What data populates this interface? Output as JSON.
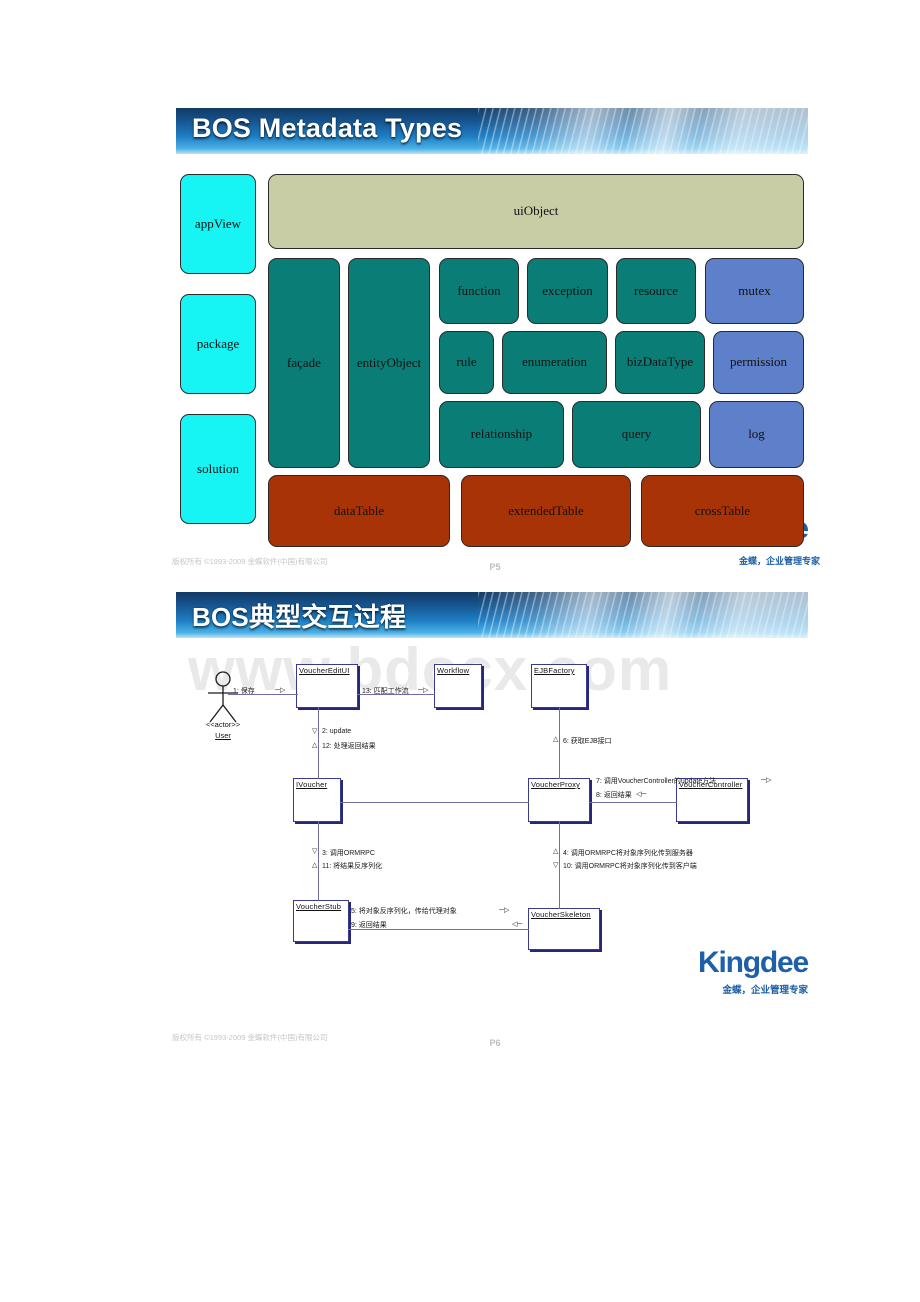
{
  "slide1": {
    "title": "BOS Metadata Types",
    "groups": {
      "left_column": [
        "appView",
        "package",
        "solution"
      ],
      "ui_layer": [
        "uiObject"
      ],
      "tall": [
        "façade",
        "entityObject"
      ],
      "row1": [
        "function",
        "exception",
        "resource",
        "mutex"
      ],
      "row2": [
        "rule",
        "enumeration",
        "bizDataType",
        "permission"
      ],
      "row3": [
        "relationship",
        "query",
        "log"
      ],
      "table_row": [
        "dataTable",
        "extendedTable",
        "crossTable"
      ]
    },
    "blocks": [
      {
        "label": "appView",
        "color": "cyan"
      },
      {
        "label": "package",
        "color": "cyan"
      },
      {
        "label": "solution",
        "color": "cyan"
      },
      {
        "label": "uiObject",
        "color": "sage"
      },
      {
        "label": "façade",
        "color": "teal"
      },
      {
        "label": "entityObject",
        "color": "teal"
      },
      {
        "label": "function",
        "color": "teal"
      },
      {
        "label": "exception",
        "color": "teal"
      },
      {
        "label": "resource",
        "color": "teal"
      },
      {
        "label": "mutex",
        "color": "blue"
      },
      {
        "label": "rule",
        "color": "teal"
      },
      {
        "label": "enumeration",
        "color": "teal"
      },
      {
        "label": "bizDataType",
        "color": "teal"
      },
      {
        "label": "permission",
        "color": "blue"
      },
      {
        "label": "relationship",
        "color": "teal"
      },
      {
        "label": "query",
        "color": "teal"
      },
      {
        "label": "log",
        "color": "blue"
      },
      {
        "label": "dataTable",
        "color": "brick"
      },
      {
        "label": "extendedTable",
        "color": "brick"
      },
      {
        "label": "crossTable",
        "color": "brick"
      }
    ],
    "logo_ghost": "e",
    "footer": {
      "copyright": "版权所有 ©1993-2009 金蝶软件(中国)有限公司",
      "page": "P5",
      "tagline": "金蝶，企业管理专家"
    }
  },
  "slide2": {
    "title": "BOS典型交互过程",
    "watermark": "www.bdocx.com",
    "actor": {
      "stereotype": "<<actor>>",
      "name": "User"
    },
    "nodes": [
      {
        "name": "VoucherEditUI"
      },
      {
        "name": "Workflow"
      },
      {
        "name": "EJBFactory"
      },
      {
        "name": "IVoucher"
      },
      {
        "name": "VoucherProxy"
      },
      {
        "name": "VoucherController"
      },
      {
        "name": "VoucherStub"
      },
      {
        "name": "VoucherSkeleton"
      }
    ],
    "messages": [
      {
        "n": "1",
        "text": "1: 保存"
      },
      {
        "n": "13",
        "text": "13: 匹配工作流"
      },
      {
        "n": "2",
        "text": "2: update"
      },
      {
        "n": "12",
        "text": "12: 处理返回结果"
      },
      {
        "n": "6",
        "text": "6: 获取EJB接口"
      },
      {
        "n": "7",
        "text": "7: 调用VoucherController的update方法"
      },
      {
        "n": "8",
        "text": "8: 返回结果"
      },
      {
        "n": "3",
        "text": "3: 调用ORMRPC"
      },
      {
        "n": "11",
        "text": "11: 将结果反序列化"
      },
      {
        "n": "4",
        "text": "4: 调用ORMRPC将对象序列化传到服务器"
      },
      {
        "n": "10",
        "text": "10: 调用ORMRPC将对象序列化传到客户端"
      },
      {
        "n": "5",
        "text": "5: 将对象反序列化，传给代理对象"
      },
      {
        "n": "9",
        "text": "9: 返回结果"
      }
    ],
    "logo": {
      "name": "Kingdee",
      "tagline": "金蝶，企业管理专家"
    },
    "footer": {
      "copyright": "版权所有 ©1993-2009 金蝶软件(中国)有限公司",
      "page": "P6",
      "tagline": ""
    }
  }
}
